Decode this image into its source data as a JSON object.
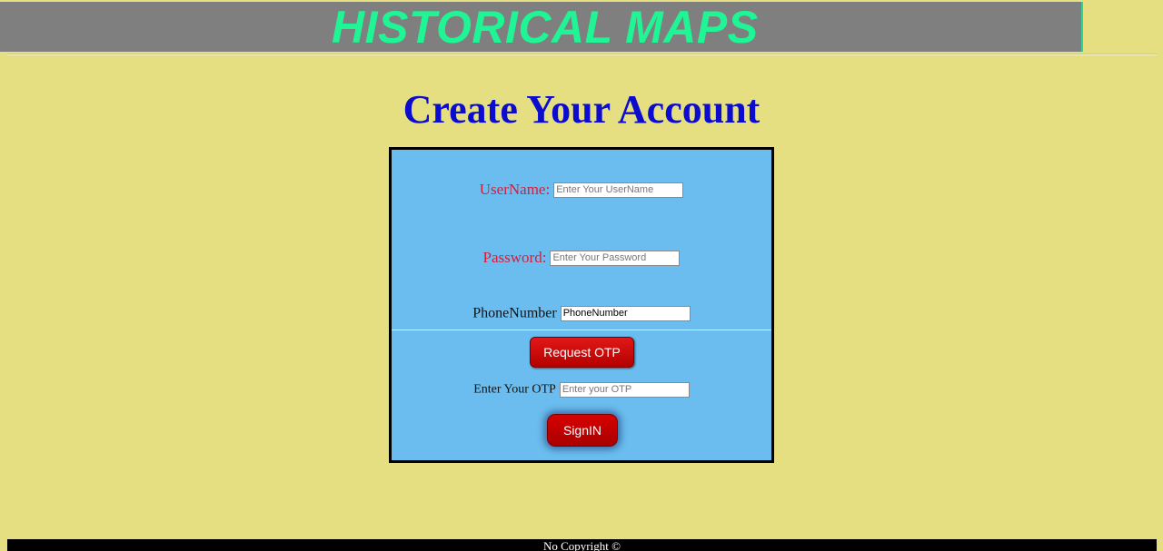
{
  "banner": {
    "title": "HISTORICAL MAPS"
  },
  "page": {
    "title": "Create Your Account"
  },
  "form": {
    "username": {
      "label": "UserName:",
      "placeholder": "Enter Your UserName"
    },
    "password": {
      "label": "Password:",
      "placeholder": "Enter Your Password"
    },
    "phone": {
      "label": "PhoneNumber",
      "value": "PhoneNumber"
    },
    "request_otp_label": "Request OTP",
    "otp": {
      "label": "Enter Your OTP",
      "placeholder": "Enter your OTP"
    },
    "signin_label": "SignIN"
  },
  "footer": {
    "text": "No Copyright ©"
  },
  "colors": {
    "page_background": "#e5df81",
    "banner_background": "#7f7f7f",
    "banner_text": "#1ff594",
    "title_text": "#0c0ccf",
    "form_background": "#6abdee",
    "label_red": "#d51d3c",
    "button_red": "#c80000",
    "footer_background": "#000000"
  }
}
